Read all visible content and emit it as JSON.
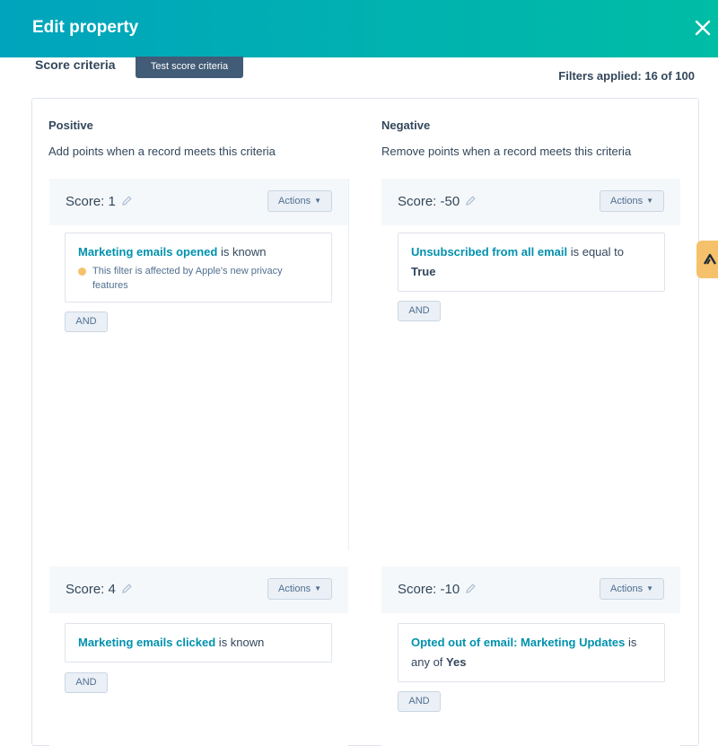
{
  "header": {
    "title": "Edit property"
  },
  "toolbar": {
    "section_title": "Score criteria",
    "test_button": "Test score criteria",
    "filters_applied": "Filters applied: 16 of 100"
  },
  "positive": {
    "heading": "Positive",
    "description": "Add points when a record meets this criteria",
    "groups": [
      {
        "score": "Score: 1",
        "actions": "Actions",
        "filter": {
          "property": "Marketing emails opened",
          "operator": " is known",
          "note": "This filter is affected by Apple's new privacy features"
        },
        "and": "AND"
      },
      {
        "score": "Score: 4",
        "actions": "Actions",
        "filter": {
          "property": "Marketing emails clicked",
          "operator": " is known"
        },
        "and": "AND"
      }
    ]
  },
  "negative": {
    "heading": "Negative",
    "description": "Remove points when a record meets this criteria",
    "groups": [
      {
        "score": "Score: -50",
        "actions": "Actions",
        "filter": {
          "property": "Unsubscribed from all email",
          "operator": " is equal to",
          "value": "True"
        },
        "and": "AND"
      },
      {
        "score": "Score: -10",
        "actions": "Actions",
        "filter": {
          "property": "Opted out of email: Marketing Updates",
          "operator": " is",
          "operator2": "any of ",
          "value": "Yes"
        },
        "and": "AND"
      }
    ]
  },
  "icons": {
    "close": "close-icon",
    "edit": "pencil-icon",
    "warning": "warning-dot-icon",
    "side_tab": "side-tab-icon"
  },
  "colors": {
    "header_start": "#00a4bd",
    "header_end": "#00bda5",
    "link": "#0091ae",
    "button_dark": "#425b76",
    "warning": "#f5c26b"
  }
}
